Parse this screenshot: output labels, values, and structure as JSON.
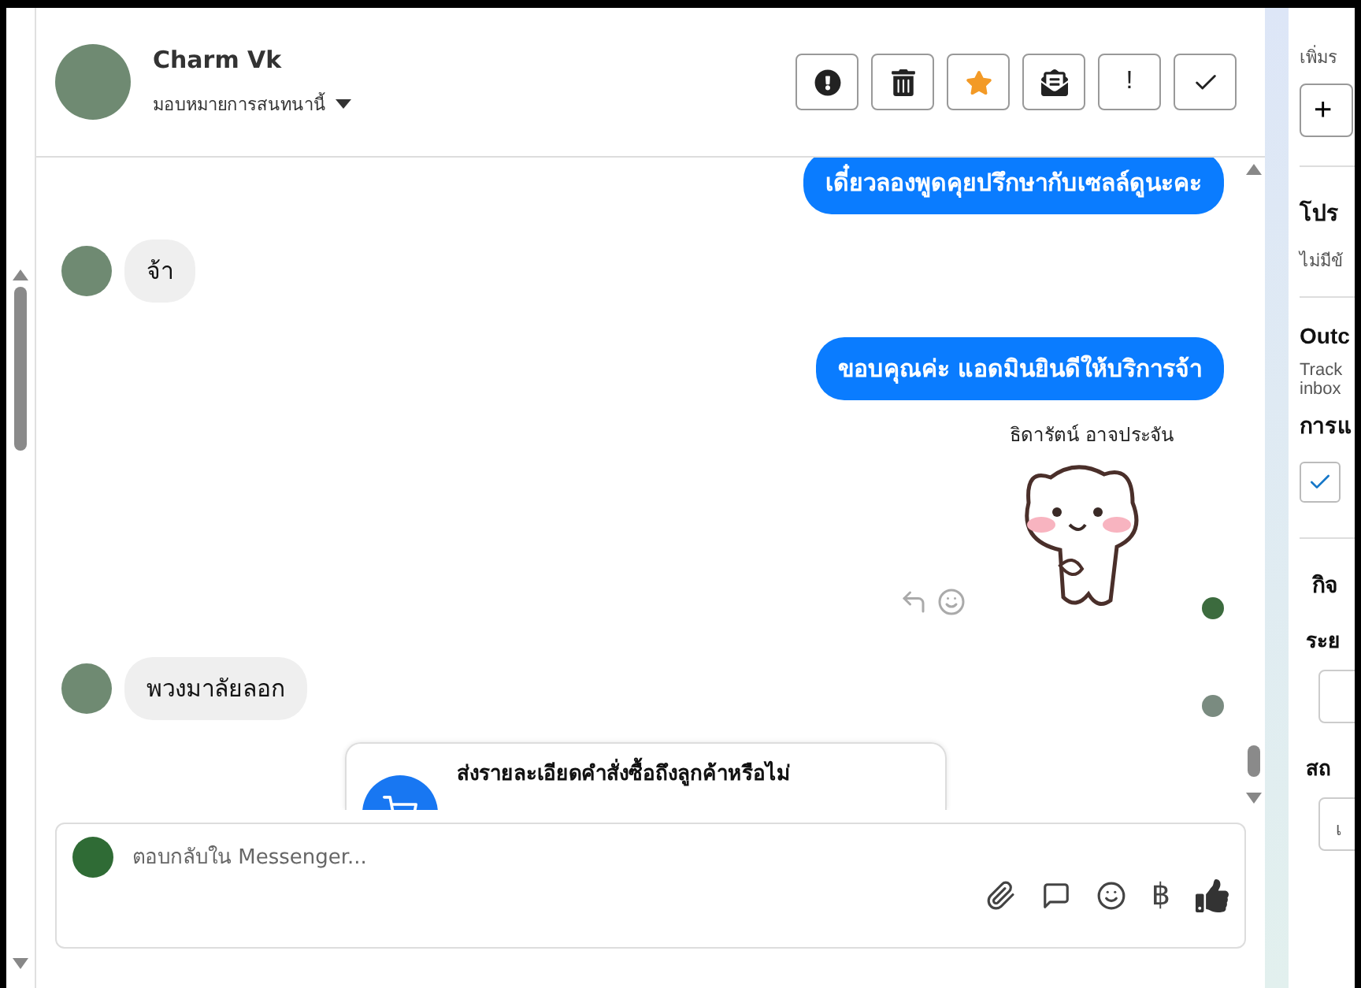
{
  "contact": {
    "name": "Charm Vk",
    "assign_label": "มอบหมายการสนทนานี้"
  },
  "actions": [
    {
      "kind": "spam"
    },
    {
      "kind": "delete"
    },
    {
      "kind": "star",
      "on": true
    },
    {
      "kind": "unread"
    },
    {
      "kind": "important",
      "glyph": "!"
    },
    {
      "kind": "done"
    }
  ],
  "messages": [
    {
      "kind": "outgoing",
      "text": "เดี๋ยวลองพูดคุยปรึกษากับเซลล์ดูนะคะ"
    },
    {
      "kind": "incoming",
      "text": "จ้า",
      "seen": false
    },
    {
      "kind": "outgoing",
      "text": "ขอบคุณค่ะ แอดมินยินดีให้บริการจ้า"
    },
    {
      "kind": "sender",
      "text": "ธิดารัตน์ อาจประจัน"
    },
    {
      "kind": "sticker"
    },
    {
      "kind": "incoming",
      "text": "พวงมาลัยลอก",
      "seen": true
    },
    {
      "kind": "card",
      "text": "ส่งรายละเอียดคำสั่งซื้อถึงลูกค้าหรือไม่"
    }
  ],
  "composer": {
    "placeholder": "ตอบกลับใน Messenger...",
    "currency": "฿"
  },
  "side": {
    "add_hint": "เพิ่มร",
    "add_button": "+",
    "promo_title": "โปร",
    "promo_text": "ไม่มีข้",
    "outcome_title": "Outc",
    "outcome_text": [
      "Track",
      "inbox"
    ],
    "outcome_label": "การแ",
    "outcome_checked": true,
    "activity_title": "กิจ",
    "period_label": "ระย",
    "status_label": "สถ",
    "status_value": "เ"
  }
}
